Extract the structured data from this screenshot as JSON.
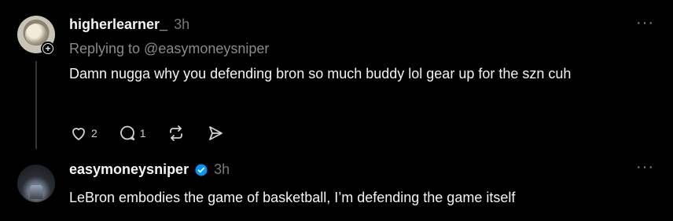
{
  "posts": [
    {
      "username": "higherlearner_",
      "time": "3h",
      "replying_to": "Replying to @easymoneysniper",
      "text": "Damn nugga why you defending bron so much buddy lol gear up for the szn cuh",
      "likes": "2",
      "replies": "1",
      "more": "···"
    },
    {
      "username": "easymoneysniper",
      "time": "3h",
      "verified": true,
      "text": "LeBron embodies the game of basketball, I’m defending the game itself",
      "more": "···"
    }
  ],
  "icons": [
    "heart-icon",
    "comment-icon",
    "repost-icon",
    "share-icon",
    "more-icon",
    "verified-icon",
    "follow-plus-icon"
  ],
  "colors": {
    "background": "#000000",
    "text": "#f3f5f7",
    "muted": "#777777",
    "verified": "#0095f6"
  }
}
